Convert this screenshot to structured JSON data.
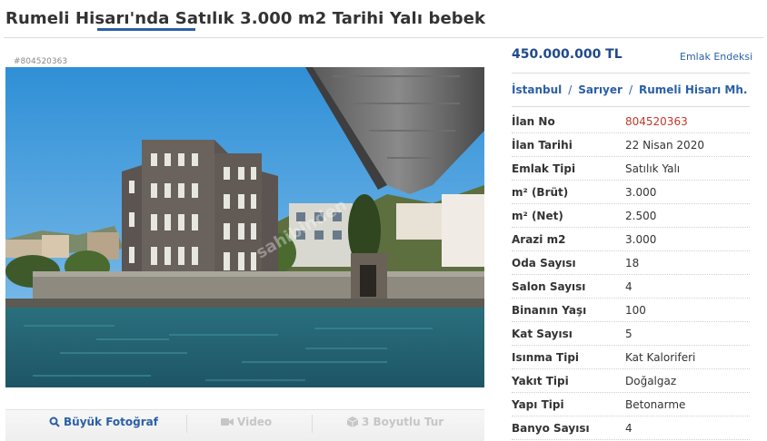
{
  "listing": {
    "title": "Rumeli Hisarı'nda Satılık 3.000 m2 Tarihi Yalı bebek",
    "id_tag": "#804520363",
    "price": "450.000.000 TL",
    "emlak_endeksi": "Emlak Endeksi",
    "watermark": "sahibinden"
  },
  "breadcrumb": [
    "İstanbul",
    "Sarıyer",
    "Rumeli Hisarı Mh."
  ],
  "media_tabs": [
    {
      "label": "Büyük Fotoğraf",
      "icon": "search-icon",
      "state": "active"
    },
    {
      "label": "Video",
      "icon": "video-camera-icon",
      "state": "disabled"
    },
    {
      "label": "3 Boyutlu Tur",
      "icon": "cube-icon",
      "state": "disabled"
    }
  ],
  "details": [
    {
      "key": "İlan No",
      "value": "804520363",
      "highlight": true
    },
    {
      "key": "İlan Tarihi",
      "value": "22 Nisan 2020"
    },
    {
      "key": "Emlak Tipi",
      "value": "Satılık Yalı"
    },
    {
      "key": "m² (Brüt)",
      "value": "3.000"
    },
    {
      "key": "m² (Net)",
      "value": "2.500"
    },
    {
      "key": "Arazi m2",
      "value": "3.000"
    },
    {
      "key": "Oda Sayısı",
      "value": "18"
    },
    {
      "key": "Salon Sayısı",
      "value": "4"
    },
    {
      "key": "Binanın Yaşı",
      "value": "100"
    },
    {
      "key": "Kat Sayısı",
      "value": "5"
    },
    {
      "key": "Isınma Tipi",
      "value": "Kat Kaloriferi"
    },
    {
      "key": "Yakıt Tipi",
      "value": "Doğalgaz"
    },
    {
      "key": "Yapı Tipi",
      "value": "Betonarme"
    },
    {
      "key": "Banyo Sayısı",
      "value": "4"
    }
  ],
  "colors": {
    "link": "#2a5fa8",
    "price": "#1f4a8a",
    "highlight": "#c0392b"
  }
}
